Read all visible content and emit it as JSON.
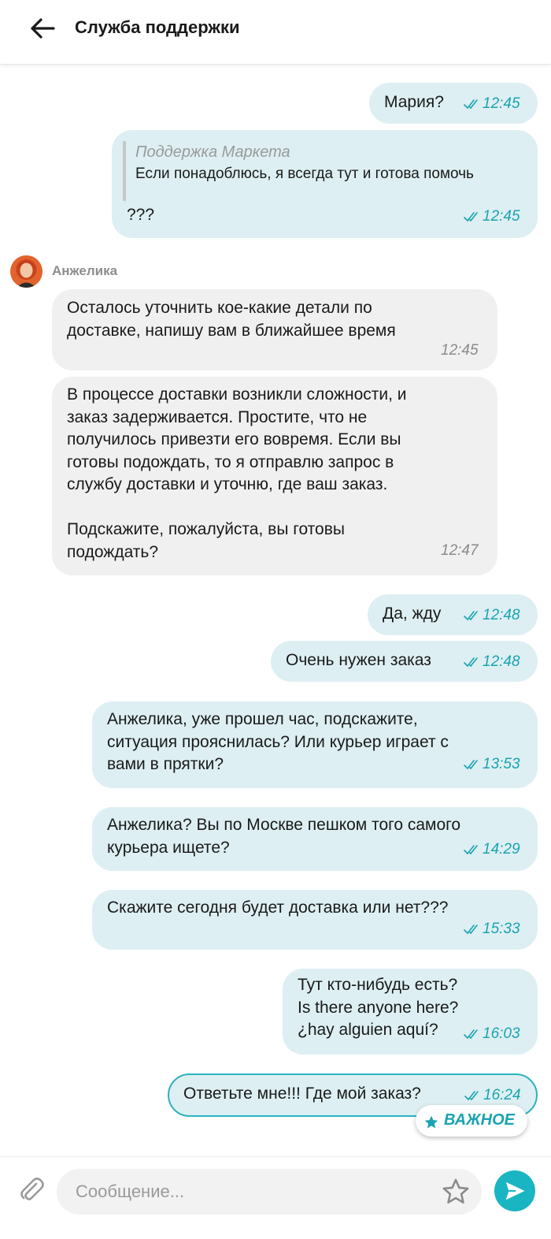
{
  "header": {
    "title": "Служба поддержки"
  },
  "messages": [
    {
      "text": "Мария?",
      "time": "12:45"
    },
    {
      "quote_author": "Поддержка Маркета",
      "quote_text": "Если понадоблюсь, я всегда тут и готова помочь",
      "text": "???",
      "time": "12:45"
    },
    {
      "sender": "Анжелика",
      "text": "Осталось уточнить кое-какие детали по\nдоставке, напишу вам в ближайшее время",
      "time": "12:45"
    },
    {
      "text": "В процессе доставки возникли сложности, и\nзаказ задерживается. Простите, что не\nполучилось привезти его вовремя. Если вы\nготовы подождать, то я отправлю запрос в\nслужбу доставки и уточню, где ваш заказ.\n\nПодскажите, пожалуйста, вы готовы\nподождать?",
      "time": "12:47"
    },
    {
      "text": "Да, жду",
      "time": "12:48"
    },
    {
      "text": "Очень нужен заказ",
      "time": "12:48"
    },
    {
      "text": "Анжелика, уже прошел час, подскажите,\nситуация прояснилась? Или курьер играет с\nвами в прятки?",
      "time": "13:53"
    },
    {
      "text": "Анжелика? Вы по Москве пешком того самого\nкурьера ищете?",
      "time": "14:29"
    },
    {
      "text": "Скажите сегодня будет доставка или нет???",
      "time": "15:33"
    },
    {
      "text": "Тут кто-нибудь есть?\n Is there anyone here?\n¿hay alguien aquí?",
      "time": "16:03"
    },
    {
      "text": "Ответьте мне!!! Где мой заказ?",
      "time": "16:24",
      "badge": "ВАЖНОЕ"
    }
  ],
  "composer": {
    "placeholder": "Сообщение..."
  },
  "colors": {
    "outgoing_bubble": "#ddeff2",
    "incoming_bubble": "#f0f0f0",
    "accent": "#1ab5c2",
    "read_ticks": "#1aa3b0"
  },
  "icons": [
    "back-arrow-icon",
    "double-check-icon",
    "avatar",
    "star-icon",
    "paperclip-icon",
    "send-icon"
  ]
}
